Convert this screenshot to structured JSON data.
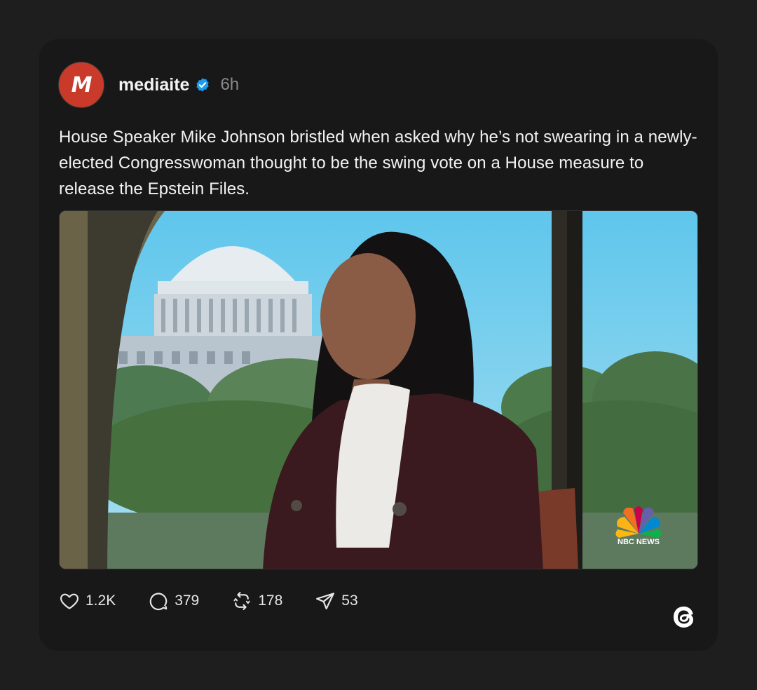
{
  "post": {
    "avatar_letter": "M",
    "username": "mediaite",
    "verified": true,
    "time": "6h",
    "text": "House Speaker Mike Johnson bristled when asked why he’s not swearing in a newly-elected Congresswoman thought to be the swing vote on a House measure to release the Epstein Files.",
    "media": {
      "watermark": "NBC NEWS"
    }
  },
  "actions": {
    "likes": "1.2K",
    "replies": "379",
    "reposts": "178",
    "shares": "53"
  },
  "icons": {
    "like": "heart-icon",
    "reply": "comment-bubble-icon",
    "repost": "repost-icon",
    "share": "send-icon",
    "brand": "threads-logo-icon",
    "verified": "verified-badge-icon"
  },
  "colors": {
    "background": "#1e1e1e",
    "card": "#181818",
    "avatar": "#c93a2a",
    "verified": "#1d9bf0",
    "muted_text": "#8a8a8a"
  }
}
